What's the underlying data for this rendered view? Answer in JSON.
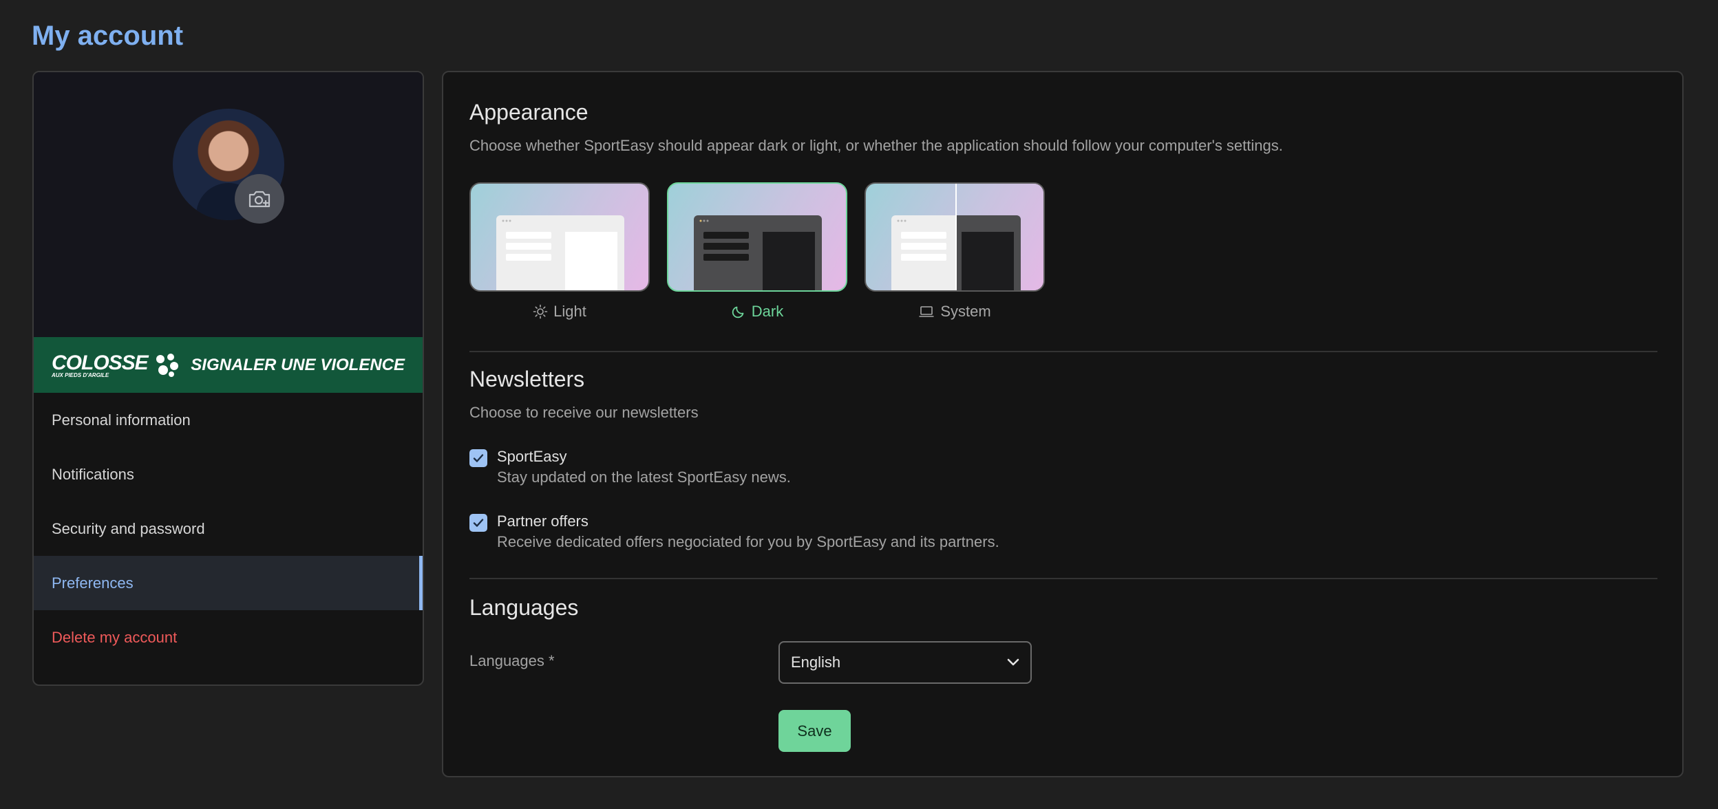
{
  "page": {
    "title": "My account"
  },
  "banner": {
    "logo_text": "COLOSSE",
    "logo_subtext": "AUX PIEDS D'ARGILE",
    "cta": "SIGNALER UNE VIOLENCE",
    "color": "#12573a"
  },
  "sidebar": {
    "items": [
      {
        "label": "Personal information"
      },
      {
        "label": "Notifications"
      },
      {
        "label": "Security and password"
      },
      {
        "label": "Preferences",
        "active": true
      },
      {
        "label": "Delete my account",
        "danger": true
      }
    ]
  },
  "appearance": {
    "title": "Appearance",
    "description": "Choose whether SportEasy should appear dark or light, or whether the application should follow your computer's settings.",
    "options": [
      {
        "label": "Light",
        "icon": "sun-icon"
      },
      {
        "label": "Dark",
        "icon": "moon-icon",
        "selected": true
      },
      {
        "label": "System",
        "icon": "laptop-icon"
      }
    ]
  },
  "newsletters": {
    "title": "Newsletters",
    "description": "Choose to receive our newsletters",
    "items": [
      {
        "title": "SportEasy",
        "description": "Stay updated on the latest SportEasy news.",
        "checked": true
      },
      {
        "title": "Partner offers",
        "description": "Receive dedicated offers negociated for you by SportEasy and its partners.",
        "checked": true
      }
    ]
  },
  "languages": {
    "title": "Languages",
    "field_label": "Languages *",
    "selected": "English"
  },
  "actions": {
    "save_label": "Save"
  },
  "colors": {
    "accent_blue": "#7fb0f0",
    "accent_green": "#6dd59a",
    "danger": "#ef5a5a"
  }
}
